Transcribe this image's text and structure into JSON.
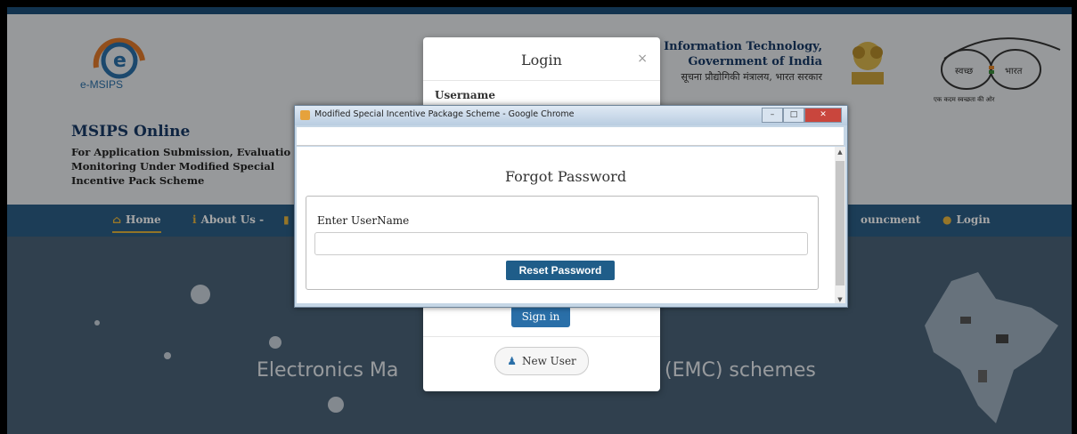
{
  "header": {
    "logo_text": "e-MSIPS",
    "site_title": "MSIPS Online",
    "site_subtitle": "For Application Submission, Evaluatio Monitoring Under Modified Special Incentive Pack Scheme",
    "ministry_line1": "nd Information Technology,",
    "ministry_line2": "Government of India",
    "ministry_hindi": "सूचना प्रौद्योगिकी मंत्रालय, भारत सरकार",
    "swachh_tag": "एक कदम स्वच्छता की ओर"
  },
  "nav": {
    "home": "Home",
    "about": "About Us -",
    "announcement": "ouncment",
    "login": "Login"
  },
  "hero": {
    "text_left": "Electronics Ma",
    "text_right": "(EMC) schemes"
  },
  "login_modal": {
    "title": "Login",
    "close": "×",
    "username_label": "Username",
    "signin_label": "Sign in",
    "new_user_label": "New User"
  },
  "popup": {
    "window_title": "Modified Special Incentive Package Scheme - Google Chrome",
    "heading": "Forgot Password",
    "field_label": "Enter UserName",
    "field_value": "",
    "field_placeholder": "",
    "reset_button": "Reset Password"
  },
  "colors": {
    "nav_bg": "#2c5f86",
    "primary_button": "#1f5d89",
    "title_color": "#183a66",
    "accent": "#e9b640"
  }
}
